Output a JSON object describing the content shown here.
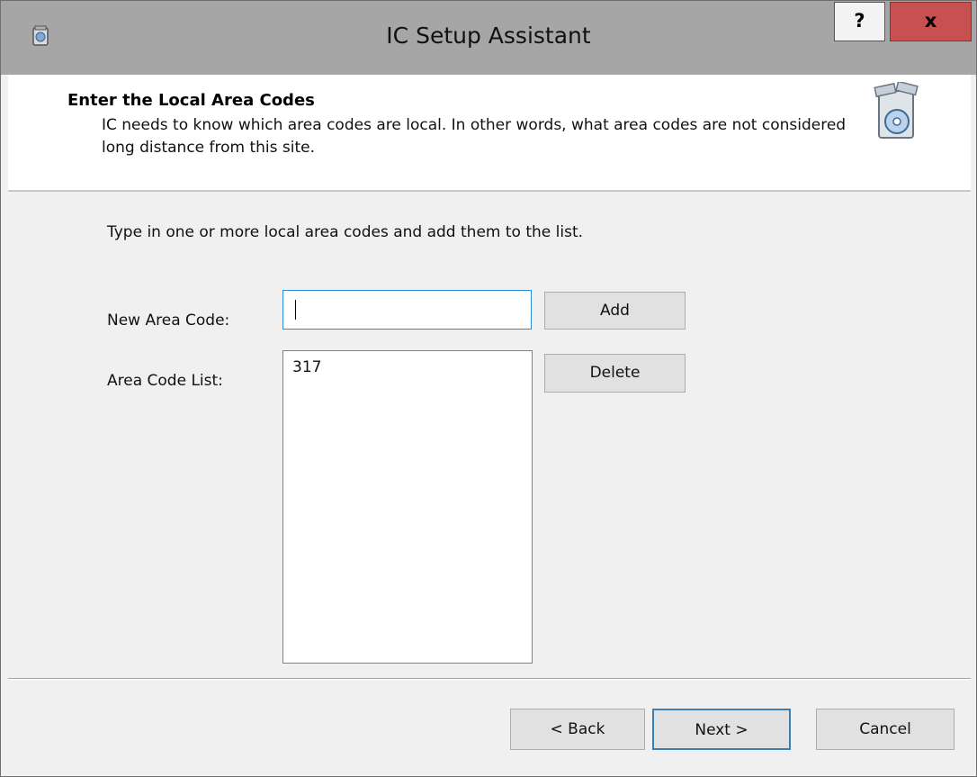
{
  "window": {
    "title": "IC Setup Assistant",
    "help_label": "?",
    "close_label": "x"
  },
  "header": {
    "title": "Enter the Local Area Codes",
    "description": "IC needs to know which area codes are local. In other words, what area codes are not considered long distance from this site."
  },
  "main": {
    "instruction": "Type in one or more local area codes and add them to the list.",
    "new_area_code_label": "New Area Code:",
    "new_area_code_value": "",
    "add_label": "Add",
    "area_code_list_label": "Area Code List:",
    "area_codes": [
      "317"
    ],
    "delete_label": "Delete"
  },
  "footer": {
    "back_label": "< Back",
    "next_label": "Next >",
    "cancel_label": "Cancel"
  }
}
